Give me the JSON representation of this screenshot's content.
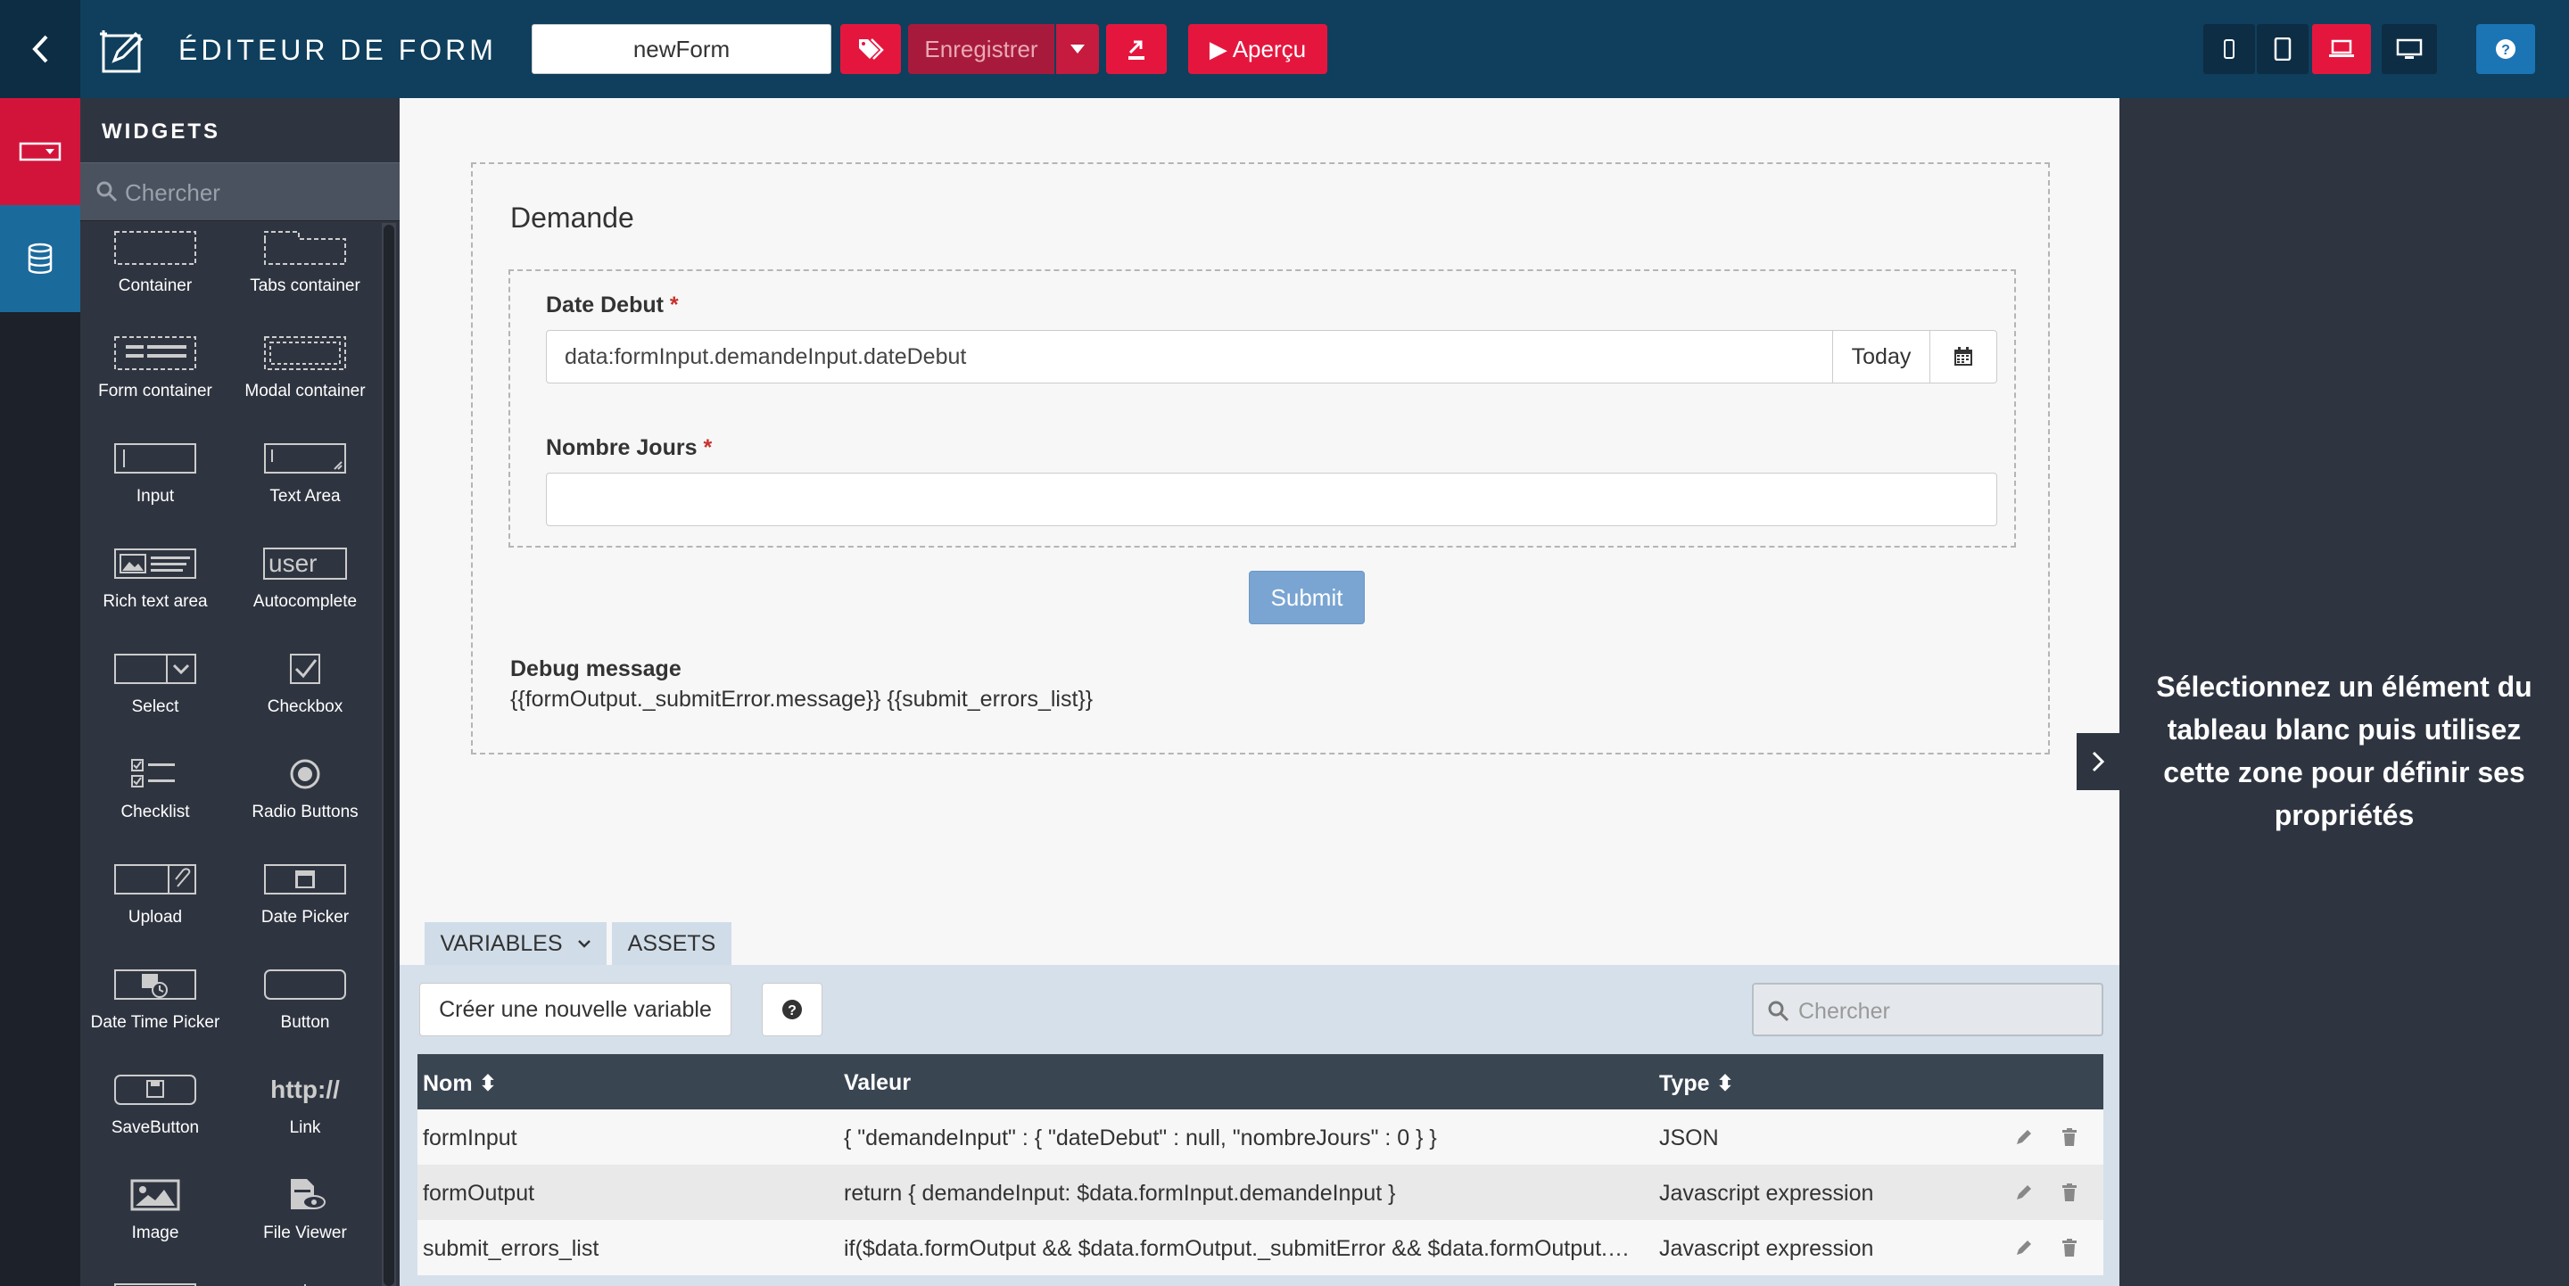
{
  "header": {
    "title": "ÉDITEUR DE FORM",
    "form_name": "newForm",
    "save_label": "Enregistrer",
    "preview_label": "▶ Aperçu"
  },
  "widgets": {
    "title": "WIDGETS",
    "search_placeholder": "Chercher",
    "items": [
      {
        "label": "Container"
      },
      {
        "label": "Tabs container"
      },
      {
        "label": "Form container"
      },
      {
        "label": "Modal container"
      },
      {
        "label": "Input"
      },
      {
        "label": "Text Area"
      },
      {
        "label": "Rich text area"
      },
      {
        "label": "Autocomplete"
      },
      {
        "label": "Select"
      },
      {
        "label": "Checkbox"
      },
      {
        "label": "Checklist"
      },
      {
        "label": "Radio Buttons"
      },
      {
        "label": "Upload"
      },
      {
        "label": "Date Picker"
      },
      {
        "label": "Date Time Picker"
      },
      {
        "label": "Button"
      },
      {
        "label": "SaveButton"
      },
      {
        "label": "Link"
      },
      {
        "label": "Image"
      },
      {
        "label": "File Viewer"
      }
    ],
    "autocomplete_icon_text": "user",
    "link_icon_text": "http://"
  },
  "form": {
    "title": "Demande",
    "date_label": "Date Debut",
    "date_value": "data:formInput.demandeInput.dateDebut",
    "today_label": "Today",
    "days_label": "Nombre Jours",
    "required_mark": "*",
    "submit_label": "Submit",
    "debug_label": "Debug message",
    "debug_value": "{{formOutput._submitError.message}} {{submit_errors_list}}"
  },
  "bottom": {
    "tab_variables": "VARIABLES",
    "tab_assets": "ASSETS",
    "new_variable_label": "Créer une nouvelle variable",
    "search_placeholder": "Chercher",
    "columns": {
      "name": "Nom",
      "value": "Valeur",
      "type": "Type"
    },
    "rows": [
      {
        "name": "formInput",
        "value": "{ \"demandeInput\" : { \"dateDebut\" : null, \"nombreJours\" : 0 } }",
        "type": "JSON"
      },
      {
        "name": "formOutput",
        "value": "return { demandeInput: $data.formInput.demandeInput }",
        "type": "Javascript expression"
      },
      {
        "name": "submit_errors_list",
        "value": "if($data.formOutput && $data.formOutput._submitError && $data.formOutput.…",
        "type": "Javascript expression"
      }
    ]
  },
  "properties": {
    "message": "Sélectionnez un élément du tableau blanc puis utilisez cette zone pour définir ses propriétés"
  },
  "colors": {
    "header_bg": "#0f3f5c",
    "accent_red": "#e5163e",
    "panel_dark": "#2f3540",
    "submit_blue": "#7aa5d2",
    "help_blue": "#1b75b5"
  }
}
